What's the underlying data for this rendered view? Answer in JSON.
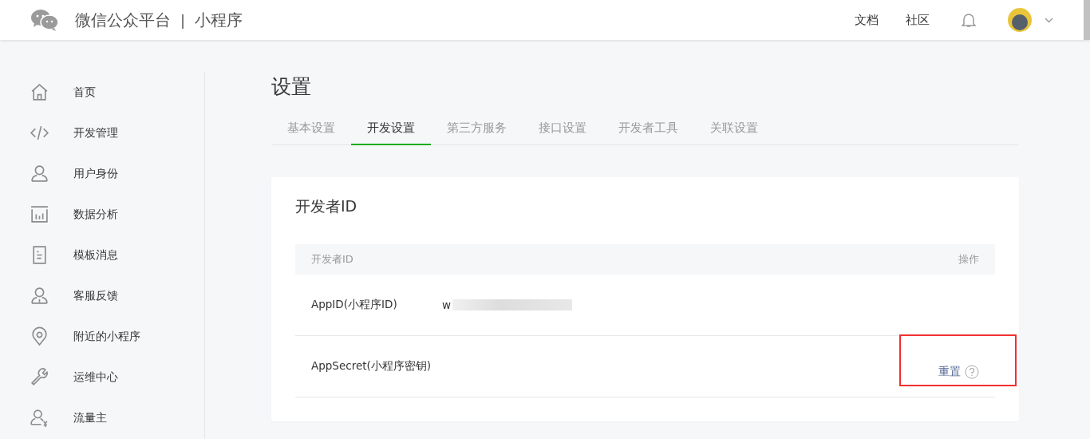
{
  "header": {
    "brand": "微信公众平台",
    "separator": "|",
    "product": "小程序",
    "links": [
      "文档",
      "社区"
    ]
  },
  "sidebar": {
    "items": [
      {
        "label": "首页"
      },
      {
        "label": "开发管理"
      },
      {
        "label": "用户身份"
      },
      {
        "label": "数据分析"
      },
      {
        "label": "模板消息"
      },
      {
        "label": "客服反馈"
      },
      {
        "label": "附近的小程序"
      },
      {
        "label": "运维中心"
      },
      {
        "label": "流量主"
      }
    ]
  },
  "page": {
    "title": "设置",
    "tabs": [
      {
        "label": "基本设置",
        "selected": false
      },
      {
        "label": "开发设置",
        "selected": true
      },
      {
        "label": "第三方服务",
        "selected": false
      },
      {
        "label": "接口设置",
        "selected": false
      },
      {
        "label": "开发者工具",
        "selected": false
      },
      {
        "label": "关联设置",
        "selected": false
      }
    ]
  },
  "card": {
    "title": "开发者ID",
    "table": {
      "columns": [
        "开发者ID",
        "操作"
      ],
      "rows": [
        {
          "name": "AppID(小程序ID)",
          "value": "w",
          "redacted": true
        },
        {
          "name": "AppSecret(小程序密钥)",
          "action": "重置",
          "highlighted": true
        }
      ]
    }
  }
}
